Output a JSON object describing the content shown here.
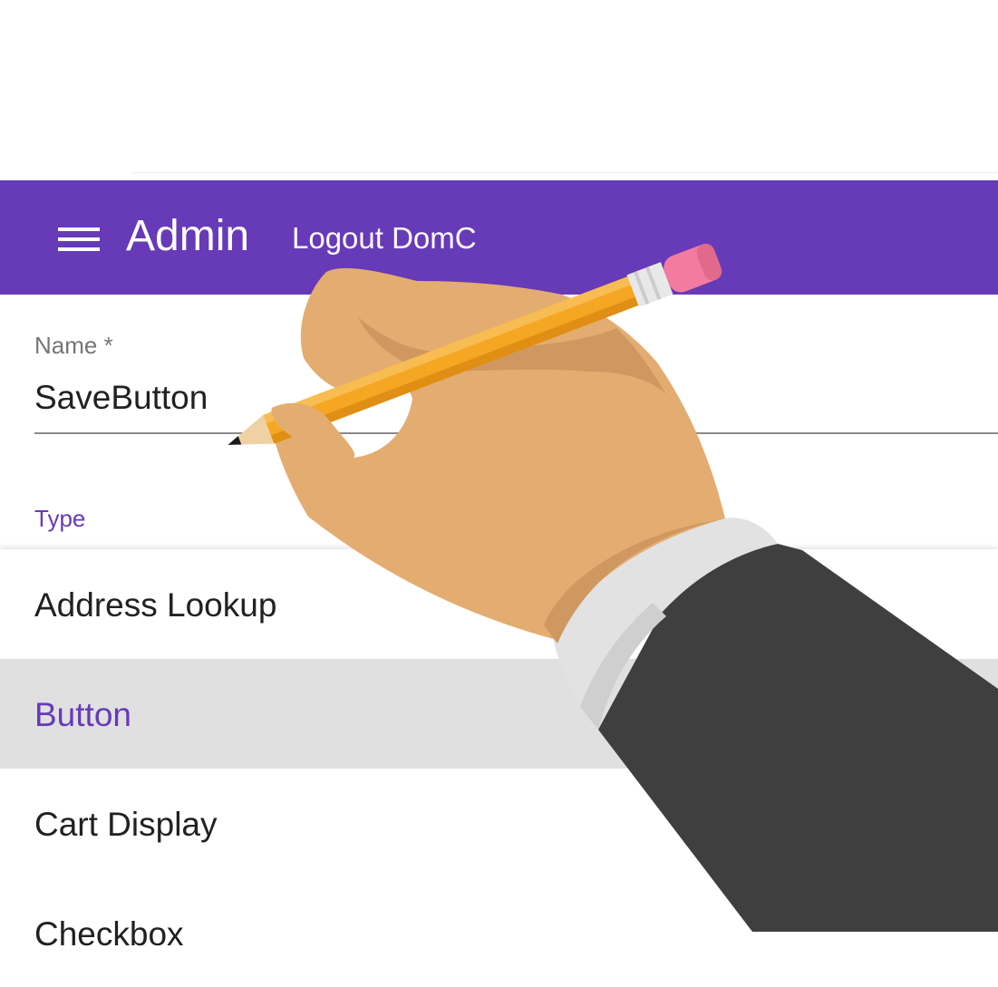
{
  "appbar": {
    "title": "Admin",
    "logout_label": "Logout DomC",
    "color": "#673ab7"
  },
  "form": {
    "name_label": "Name *",
    "name_value": "SaveButton",
    "type_label": "Type"
  },
  "dropdown": {
    "options": [
      {
        "label": "Address Lookup",
        "selected": false
      },
      {
        "label": "Button",
        "selected": true
      },
      {
        "label": "Cart Display",
        "selected": false
      },
      {
        "label": "Checkbox",
        "selected": false
      }
    ]
  },
  "icons": {
    "menu": "hamburger-menu-icon"
  },
  "illustration": {
    "subject": "hand holding pencil"
  }
}
